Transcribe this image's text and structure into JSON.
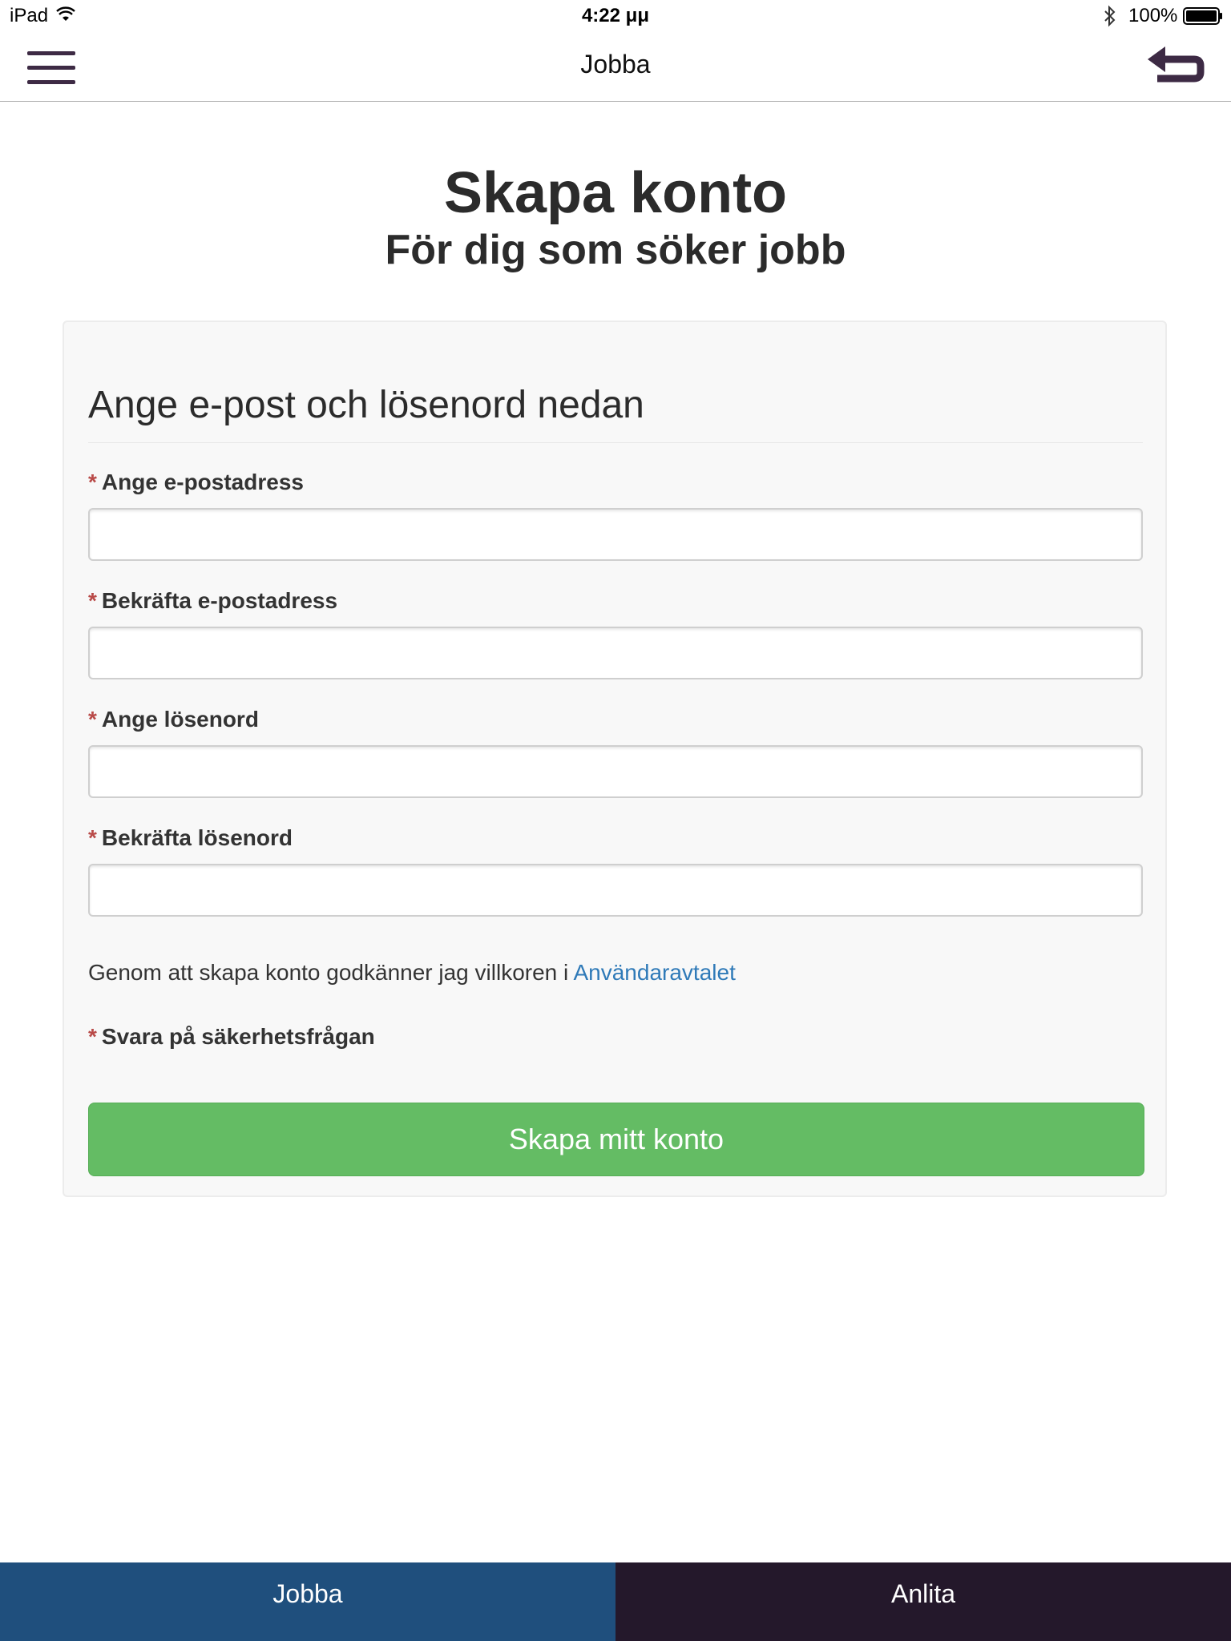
{
  "status_bar": {
    "device": "iPad",
    "time": "4:22 μμ",
    "battery": "100%"
  },
  "nav": {
    "title": "Jobba"
  },
  "header": {
    "title": "Skapa konto",
    "subtitle": "För dig som söker jobb"
  },
  "form": {
    "heading": "Ange e-post och lösenord nedan",
    "required_marker": "*",
    "fields": [
      {
        "label": "Ange e-postadress",
        "value": "",
        "placeholder": ""
      },
      {
        "label": "Bekräfta e-postadress",
        "value": "",
        "placeholder": ""
      },
      {
        "label": "Ange lösenord",
        "value": "",
        "placeholder": ""
      },
      {
        "label": "Bekräfta lösenord",
        "value": "",
        "placeholder": ""
      }
    ],
    "terms_text": "Genom att skapa konto godkänner jag villkoren i ",
    "terms_link": "Användaravtalet",
    "security_label": "Svara på säkerhetsfrågan",
    "submit_label": "Skapa mitt konto"
  },
  "tabs": [
    {
      "label": "Jobba",
      "active": true
    },
    {
      "label": "Anlita",
      "active": false
    }
  ],
  "colors": {
    "accent_green": "#64bc64",
    "link_blue": "#2f7ab8",
    "tab_active": "#1f4f7d",
    "tab_inactive": "#24182b",
    "icon_purple": "#3d2a44",
    "required_red": "#b94a48"
  }
}
